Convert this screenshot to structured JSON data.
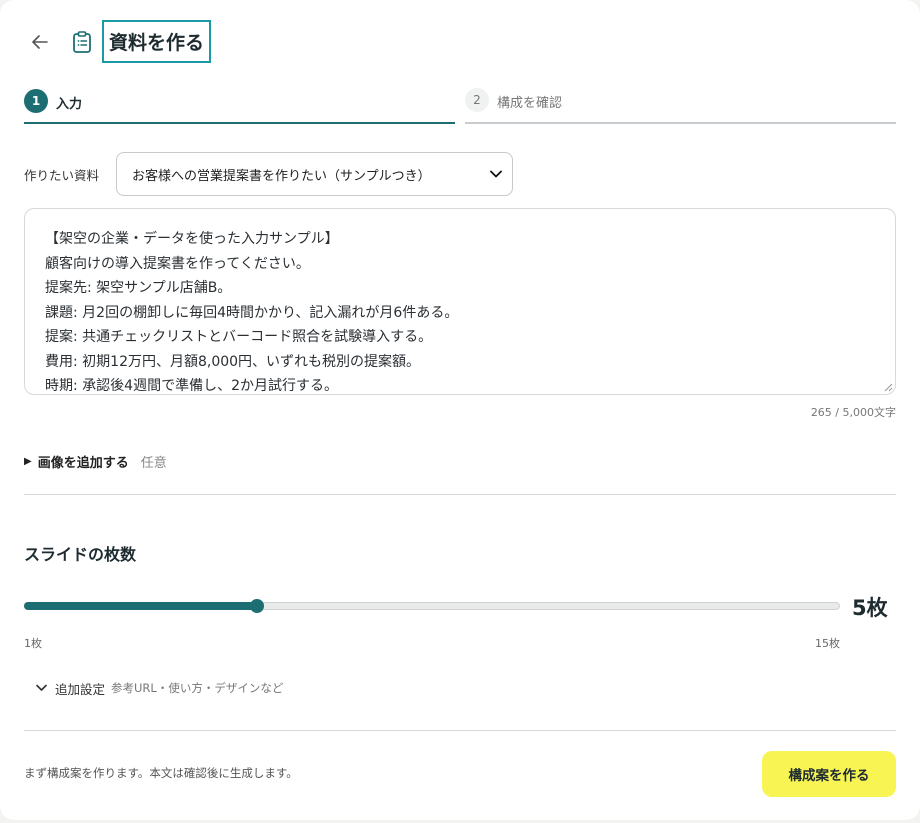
{
  "header": {
    "back_icon": "arrow-left-icon",
    "page_icon": "clipboard-icon",
    "title": "資料を作る"
  },
  "steps": [
    {
      "num": "1",
      "label": "入力",
      "active": true
    },
    {
      "num": "2",
      "label": "構成を確認",
      "active": false
    }
  ],
  "form": {
    "type_label": "作りたい資料",
    "type_selected": "お客様への営業提案書を作りたい（サンプルつき）",
    "content_lines": [
      "【架空の企業・データを使った入力サンプル】",
      "顧客向けの導入提案書を作ってください。",
      "提案先: 架空サンプル店舗B。",
      "課題: 月2回の棚卸しに毎回4時間かかり、記入漏れが月6件ある。",
      "提案: 共通チェックリストとバーコード照合を試験導入する。",
      "費用: 初期12万円、月額8,000円、いずれも税別の提案額。",
      "時期: 承認後4週間で準備し、2か月試行する。"
    ],
    "char_count": "265 / 5,000文字"
  },
  "images": {
    "label": "画像を追加する",
    "optional": "任意"
  },
  "slides": {
    "title": "スライドの枚数",
    "value": 5,
    "min": 1,
    "max": 15,
    "value_label": "5枚",
    "min_label": "1枚",
    "max_label": "15枚"
  },
  "advanced": {
    "label": "追加設定",
    "hint": "参考URL・使い方・デザインなど"
  },
  "footer": {
    "note": "まず構成案を作ります。本文は確認後に生成します。",
    "submit_label": "構成案を作る"
  },
  "colors": {
    "accent": "#1d6e73",
    "cta": "#f7f454",
    "title_outline": "#1a9aa4"
  }
}
